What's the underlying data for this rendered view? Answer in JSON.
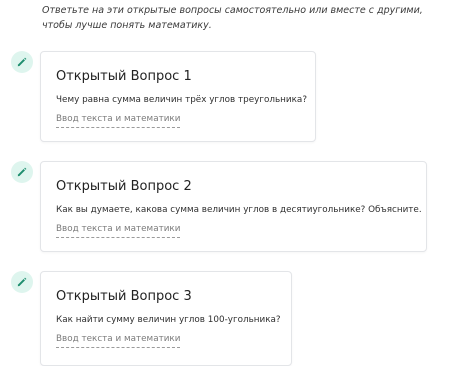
{
  "intro": "Ответьте на эти открытые вопросы самостоятельно или вместе с другими, чтобы лучше понять математику.",
  "questions": [
    {
      "title": "Открытый Вопрос 1",
      "text": "Чему равна сумма величин трёх углов треугольника?",
      "placeholder": "Ввод текста и математики"
    },
    {
      "title": "Открытый Вопрос 2",
      "text": "Как вы думаете, какова сумма величин углов в десятиугольнике? Объясните.",
      "placeholder": "Ввод текста и математики"
    },
    {
      "title": "Открытый Вопрос 3",
      "text": "Как найти сумму величин углов 100-угольника?",
      "placeholder": "Ввод текста и математики"
    }
  ],
  "icon": "pencil-icon",
  "colors": {
    "icon_bg": "#def5ee",
    "icon_fg": "#1e8e6e",
    "card_border": "#e3e5e8"
  }
}
